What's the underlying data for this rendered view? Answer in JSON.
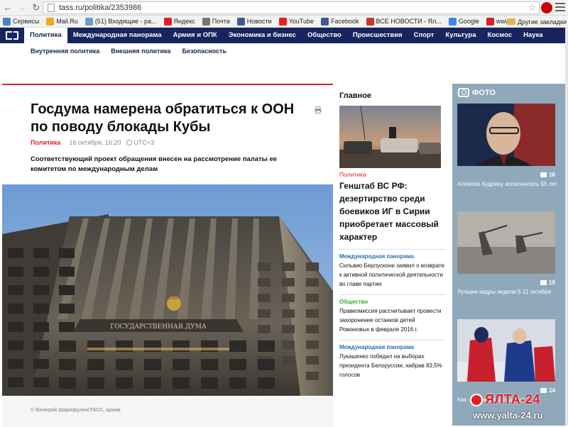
{
  "browser": {
    "url": "tass.ru/politika/2353986",
    "bookmarks": [
      {
        "label": "Сервисы",
        "color": "#4a7fd4"
      },
      {
        "label": "Mail.Ru",
        "color": "#f5a623"
      },
      {
        "label": "(51) Входящие - ра...",
        "color": "#6c9bd2"
      },
      {
        "label": "Яндекс",
        "color": "#e31e24"
      },
      {
        "label": "Почта",
        "color": "#777"
      },
      {
        "label": "Новости",
        "color": "#3b5998"
      },
      {
        "label": "YouTube",
        "color": "#e62117"
      },
      {
        "label": "Facebook",
        "color": "#3b5998"
      },
      {
        "label": "ВСЕ НОВОСТИ - Ял...",
        "color": "#c0392b"
      },
      {
        "label": "Google",
        "color": "#4285f4"
      },
      {
        "label": "www.yalta-24.ru inf...",
        "color": "#e31e24"
      }
    ],
    "other_bookmarks": "Другие закладки"
  },
  "nav": {
    "items": [
      "Политика",
      "Международная панорама",
      "Армия и ОПК",
      "Экономика и бизнес",
      "Общество",
      "Происшествия",
      "Спорт",
      "Культура",
      "Космос",
      "Наука"
    ],
    "sub_items": [
      "Внутренняя политика",
      "Внешняя политика",
      "Безопасность"
    ]
  },
  "article": {
    "title": "Госдума намерена обратиться к ООН по поводу блокады Кубы",
    "rubric": "Политика",
    "date": "16 октября, 16:20",
    "tz": "UTC+3",
    "lead": "Соответствующий проект обращения внесен на рассмотрение палаты ее комитетом по международным делам",
    "building_sign": "ГОСУДАРСТВЕННАЯ ДУМА",
    "caption": "© Валерий Шарифулин/ТАСС, архив"
  },
  "main_block": {
    "heading": "Главное",
    "rubric": "Политика",
    "title": "Генштаб ВС РФ: дезертирство среди боевиков ИГ в Сирии приобретает массовый характер",
    "items": [
      {
        "rubric": "Международная панорама",
        "text": "Сильвио Берлускони заявил о возврате к активной политической деятельности во главе партии"
      },
      {
        "rubric": "Общество",
        "text": "Правкомиссия рассчитывает провести захоронение останков детей Романовых в феврале 2016 г."
      },
      {
        "rubric": "Международная панорама",
        "text": "Лукашенко победил на выборах президента Белоруссии, набрав 83,5% голосов"
      }
    ]
  },
  "photo": {
    "heading": "ФОТО",
    "items": [
      {
        "count": "16",
        "text": "Алексею Кудрину исполнилось 55 лет"
      },
      {
        "count": "19",
        "text": "Лучшие кадры недели 5-11 октября"
      },
      {
        "count": "14",
        "text": "Как ... свои дни рождения"
      }
    ]
  },
  "watermark": {
    "brand": "ЯЛТА-24",
    "url": "www.yalta-24.ru"
  }
}
